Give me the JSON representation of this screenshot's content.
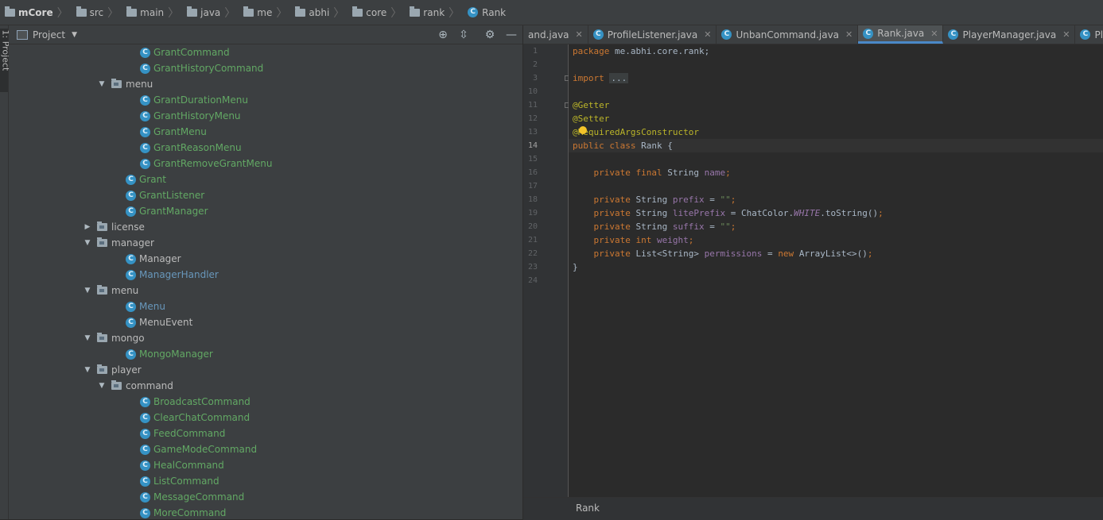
{
  "breadcrumb": [
    "mCore",
    "src",
    "main",
    "java",
    "me",
    "abhi",
    "core",
    "rank",
    "Rank"
  ],
  "side_tab": "1: Project",
  "project_panel": {
    "title": "Project",
    "tree": [
      {
        "depth": 2,
        "type": "class",
        "name": "GrantCommand",
        "color": "green"
      },
      {
        "depth": 2,
        "type": "class",
        "name": "GrantHistoryCommand",
        "color": "green"
      },
      {
        "depth": 1,
        "type": "dir",
        "expanded": true,
        "name": "menu"
      },
      {
        "depth": 2,
        "type": "class",
        "name": "GrantDurationMenu",
        "color": "green"
      },
      {
        "depth": 2,
        "type": "class",
        "name": "GrantHistoryMenu",
        "color": "green"
      },
      {
        "depth": 2,
        "type": "class",
        "name": "GrantMenu",
        "color": "green"
      },
      {
        "depth": 2,
        "type": "class",
        "name": "GrantReasonMenu",
        "color": "green"
      },
      {
        "depth": 2,
        "type": "class",
        "name": "GrantRemoveGrantMenu",
        "color": "green"
      },
      {
        "depth": 1,
        "type": "class",
        "name": "Grant",
        "color": "green"
      },
      {
        "depth": 1,
        "type": "class",
        "name": "GrantListener",
        "color": "green"
      },
      {
        "depth": 1,
        "type": "class",
        "name": "GrantManager",
        "color": "green"
      },
      {
        "depth": 0,
        "type": "dir",
        "expanded": false,
        "name": "license"
      },
      {
        "depth": 0,
        "type": "dir",
        "expanded": true,
        "name": "manager"
      },
      {
        "depth": 1,
        "type": "class",
        "name": "Manager",
        "color": "plain"
      },
      {
        "depth": 1,
        "type": "class",
        "name": "ManagerHandler",
        "color": "blue"
      },
      {
        "depth": 0,
        "type": "dir",
        "expanded": true,
        "name": "menu"
      },
      {
        "depth": 1,
        "type": "class",
        "name": "Menu",
        "color": "blue"
      },
      {
        "depth": 1,
        "type": "class",
        "name": "MenuEvent",
        "color": "plain"
      },
      {
        "depth": 0,
        "type": "dir",
        "expanded": true,
        "name": "mongo"
      },
      {
        "depth": 1,
        "type": "class",
        "name": "MongoManager",
        "color": "green"
      },
      {
        "depth": 0,
        "type": "dir",
        "expanded": true,
        "name": "player"
      },
      {
        "depth": 1,
        "type": "dir",
        "expanded": true,
        "name": "command"
      },
      {
        "depth": 2,
        "type": "class",
        "name": "BroadcastCommand",
        "color": "green"
      },
      {
        "depth": 2,
        "type": "class",
        "name": "ClearChatCommand",
        "color": "green"
      },
      {
        "depth": 2,
        "type": "class",
        "name": "FeedCommand",
        "color": "green"
      },
      {
        "depth": 2,
        "type": "class",
        "name": "GameModeCommand",
        "color": "green"
      },
      {
        "depth": 2,
        "type": "class",
        "name": "HealCommand",
        "color": "green"
      },
      {
        "depth": 2,
        "type": "class",
        "name": "ListCommand",
        "color": "green"
      },
      {
        "depth": 2,
        "type": "class",
        "name": "MessageCommand",
        "color": "green"
      },
      {
        "depth": 2,
        "type": "class",
        "name": "MoreCommand",
        "color": "green"
      }
    ]
  },
  "editor": {
    "tabs": [
      {
        "label": "and.java",
        "icon": false,
        "active": false
      },
      {
        "label": "ProfileListener.java",
        "icon": true,
        "active": false
      },
      {
        "label": "UnbanCommand.java",
        "icon": true,
        "active": false
      },
      {
        "label": "Rank.java",
        "icon": true,
        "active": true
      },
      {
        "label": "PlayerManager.java",
        "icon": true,
        "active": false
      },
      {
        "label": "PlayerListene",
        "icon": true,
        "active": false
      }
    ],
    "line_numbers": [
      "1",
      "2",
      "3",
      "10",
      "11",
      "12",
      "13",
      "14",
      "15",
      "16",
      "17",
      "18",
      "19",
      "20",
      "21",
      "22",
      "23",
      "24"
    ],
    "current_line": "14",
    "code_lines": [
      [
        [
          "kw",
          "package "
        ],
        [
          "",
          "me.abhi.core.rank;"
        ]
      ],
      [],
      [
        [
          "kw",
          "import "
        ],
        [
          "fold-hint",
          "..."
        ]
      ],
      [],
      [
        [
          "ann",
          "@Getter"
        ]
      ],
      [
        [
          "ann",
          "@Setter"
        ]
      ],
      [
        [
          "ann",
          "@RequiredArgsConstructor"
        ]
      ],
      [
        [
          "kw",
          "public class "
        ],
        [
          "",
          "Rank {"
        ]
      ],
      [],
      [
        [
          "",
          "    "
        ],
        [
          "kw",
          "private final "
        ],
        [
          "",
          "String "
        ],
        [
          "fld",
          "name"
        ],
        [
          "kw",
          ";"
        ]
      ],
      [],
      [
        [
          "",
          "    "
        ],
        [
          "kw",
          "private "
        ],
        [
          "",
          "String "
        ],
        [
          "fld",
          "prefix"
        ],
        [
          "",
          " = "
        ],
        [
          "str",
          "\"\""
        ],
        [
          "kw",
          ";"
        ]
      ],
      [
        [
          "",
          "    "
        ],
        [
          "kw",
          "private "
        ],
        [
          "",
          "String "
        ],
        [
          "fld",
          "litePrefix"
        ],
        [
          "",
          " = ChatColor."
        ],
        [
          "stat",
          "WHITE"
        ],
        [
          "",
          ".toString()"
        ],
        [
          "kw",
          ";"
        ]
      ],
      [
        [
          "",
          "    "
        ],
        [
          "kw",
          "private "
        ],
        [
          "",
          "String "
        ],
        [
          "fld",
          "suffix"
        ],
        [
          "",
          " = "
        ],
        [
          "str",
          "\"\""
        ],
        [
          "kw",
          ";"
        ]
      ],
      [
        [
          "",
          "    "
        ],
        [
          "kw",
          "private int "
        ],
        [
          "fld",
          "weight"
        ],
        [
          "kw",
          ";"
        ]
      ],
      [
        [
          "",
          "    "
        ],
        [
          "kw",
          "private "
        ],
        [
          "",
          "List<String> "
        ],
        [
          "fld",
          "permissions"
        ],
        [
          "",
          " = "
        ],
        [
          "kw",
          "new "
        ],
        [
          "",
          "ArrayList<>()"
        ],
        [
          "kw",
          ";"
        ]
      ],
      [
        [
          "",
          "}"
        ]
      ],
      []
    ],
    "footer_label": "Rank"
  },
  "colors": {
    "background": "#2b2b2b",
    "panel": "#3c3f41",
    "keyword": "#cc7832",
    "annotation": "#bbb529",
    "field": "#9876aa",
    "string": "#6a8759",
    "class_icon": "#3592c4",
    "tree_green": "#62a864",
    "tree_blue": "#6897bb"
  }
}
